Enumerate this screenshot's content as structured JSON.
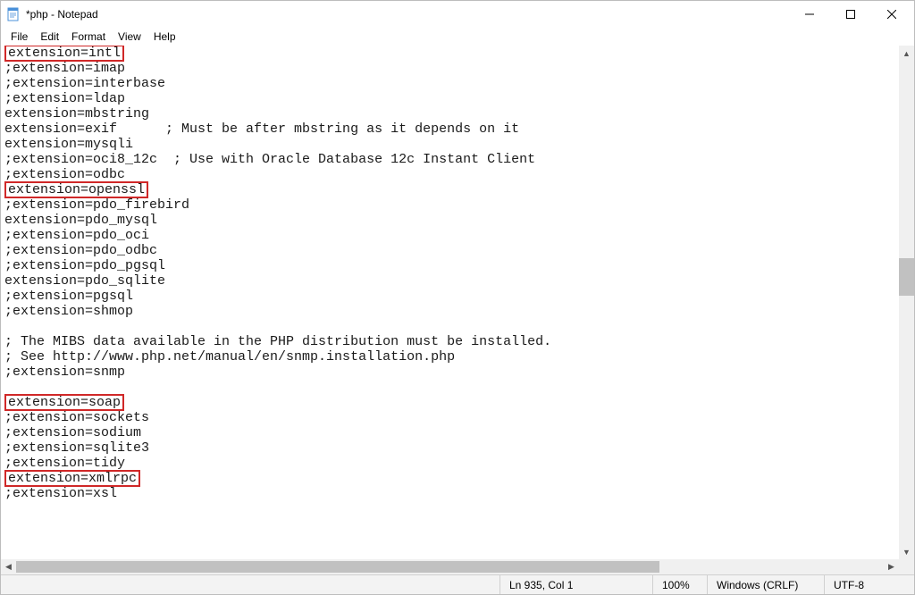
{
  "titlebar": {
    "title": "*php - Notepad"
  },
  "menu": {
    "file": "File",
    "edit": "Edit",
    "format": "Format",
    "view": "View",
    "help": "Help"
  },
  "content": {
    "lines": [
      {
        "text": "extension=intl",
        "highlight": true
      },
      {
        "text": ";extension=imap"
      },
      {
        "text": ";extension=interbase"
      },
      {
        "text": ";extension=ldap"
      },
      {
        "text": "extension=mbstring"
      },
      {
        "text": "extension=exif      ; Must be after mbstring as it depends on it"
      },
      {
        "text": "extension=mysqli"
      },
      {
        "text": ";extension=oci8_12c  ; Use with Oracle Database 12c Instant Client"
      },
      {
        "text": ";extension=odbc"
      },
      {
        "text": "extension=openssl",
        "highlight": true
      },
      {
        "text": ";extension=pdo_firebird"
      },
      {
        "text": "extension=pdo_mysql"
      },
      {
        "text": ";extension=pdo_oci"
      },
      {
        "text": ";extension=pdo_odbc"
      },
      {
        "text": ";extension=pdo_pgsql"
      },
      {
        "text": "extension=pdo_sqlite"
      },
      {
        "text": ";extension=pgsql"
      },
      {
        "text": ";extension=shmop"
      },
      {
        "text": ""
      },
      {
        "text": "; The MIBS data available in the PHP distribution must be installed."
      },
      {
        "text": "; See http://www.php.net/manual/en/snmp.installation.php"
      },
      {
        "text": ";extension=snmp"
      },
      {
        "text": ""
      },
      {
        "text": "extension=soap",
        "highlight": true
      },
      {
        "text": ";extension=sockets"
      },
      {
        "text": ";extension=sodium"
      },
      {
        "text": ";extension=sqlite3"
      },
      {
        "text": ";extension=tidy"
      },
      {
        "text": "extension=xmlrpc",
        "highlight": true
      },
      {
        "text": ";extension=xsl"
      }
    ]
  },
  "status": {
    "position": "Ln 935, Col 1",
    "zoom": "100%",
    "line_ending": "Windows (CRLF)",
    "encoding": "UTF-8"
  }
}
